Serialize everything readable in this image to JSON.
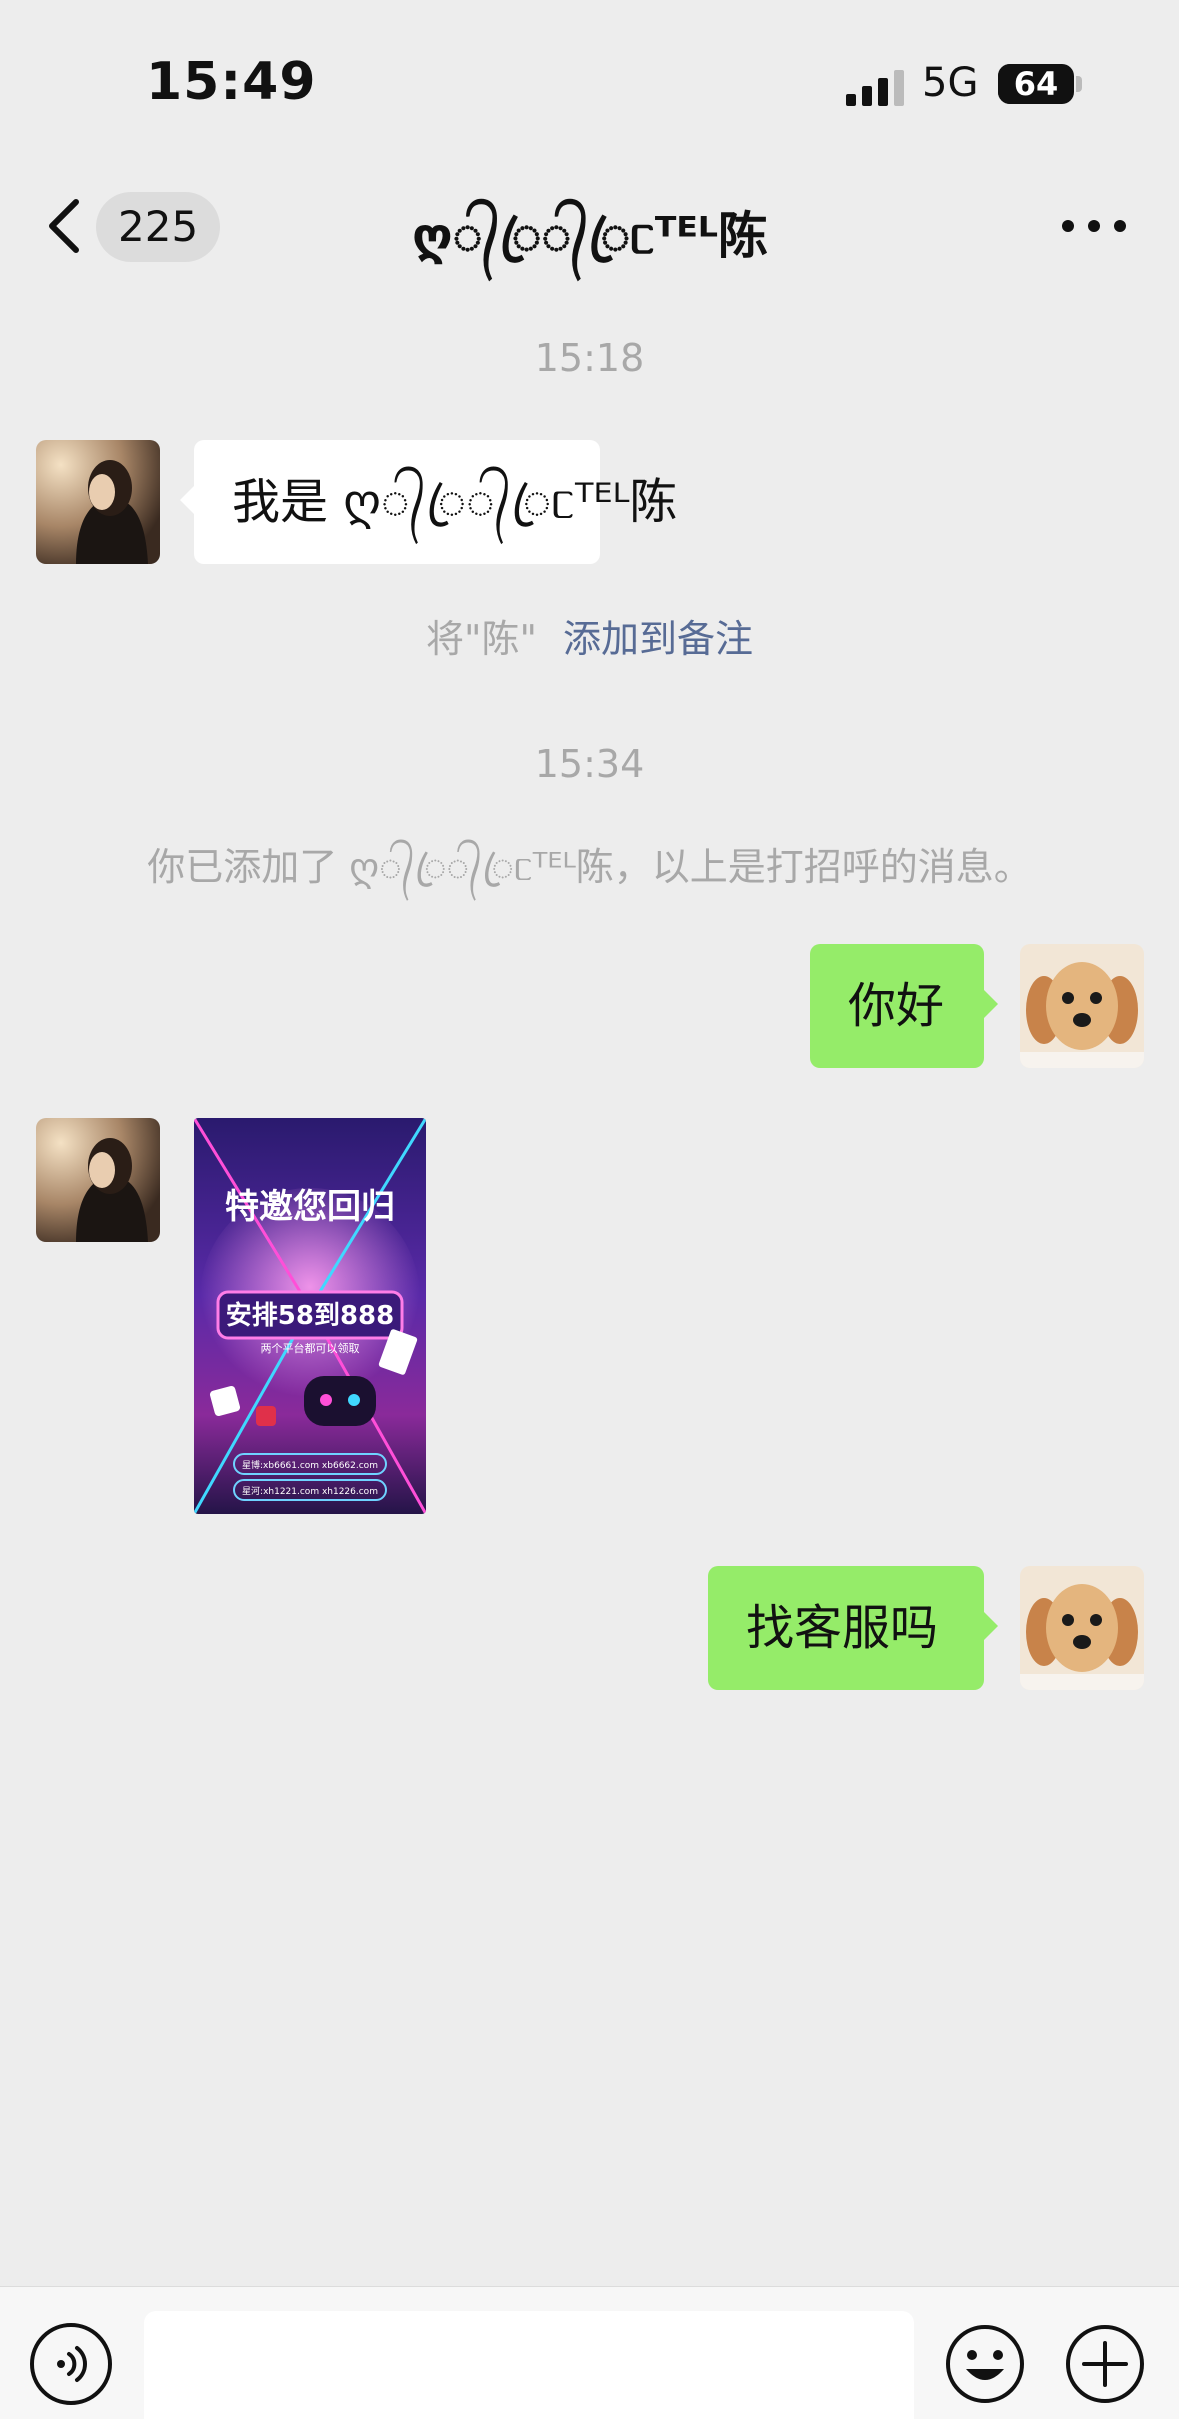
{
  "status_bar": {
    "time": "15:49",
    "network": "5G",
    "battery": "64",
    "battery_level": 0.64
  },
  "nav": {
    "unread_count": "225",
    "title": "ღ᭄ꦿ᭄ꦿᥴᵀᴱᴸ陈"
  },
  "messages": {
    "time_1": "15:18",
    "greeting": "我是 ღ᭄ꦿ᭄ꦿᥴᵀᴱᴸ陈",
    "remark_prefix": "将\"陈\"",
    "remark_link": "添加到备注",
    "time_2": "15:34",
    "added_note": "你已添加了 ღ᭄ꦿ᭄ꦿᥴᵀᴱᴸ陈，以上是打招呼的消息。",
    "hello": "你好",
    "ask_service": "找客服吗"
  },
  "poster": {
    "headline": "特邀您回归",
    "offer": "安排58到888",
    "offer_sub": "两个平台都可以领取",
    "url_line_1": "星博:xb6661.com xb6662.com",
    "url_line_2": "星河:xh1221.com xh1226.com"
  },
  "colors": {
    "background": "#ededed",
    "bubble_out": "#95ec69",
    "bubble_in": "#ffffff",
    "link": "#576b95",
    "meta_text": "#a8a8a8"
  },
  "icons": {
    "back": "chevron-left-icon",
    "more": "more-dots-icon",
    "voice": "voice-icon",
    "emoji": "emoji-icon",
    "plus": "plus-icon"
  }
}
